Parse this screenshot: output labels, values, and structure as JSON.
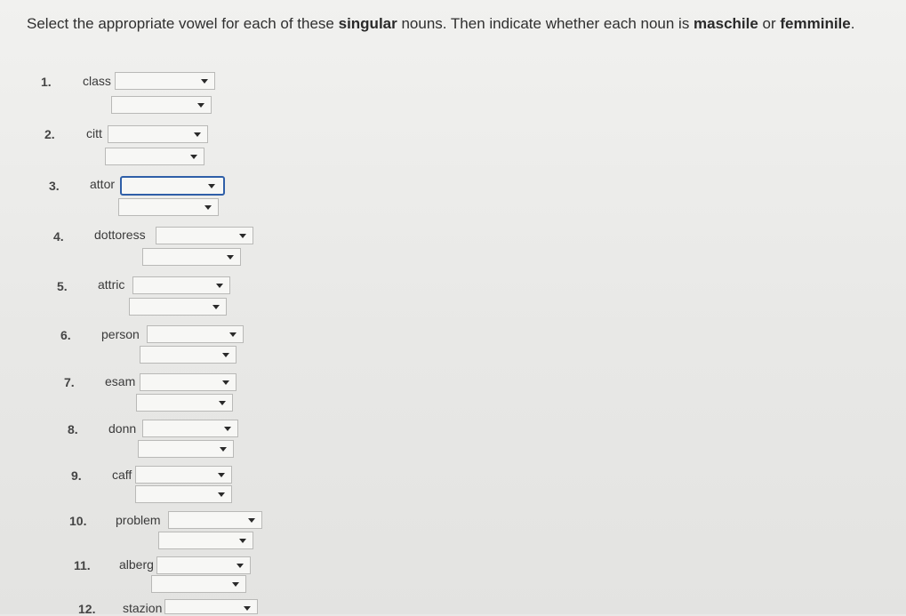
{
  "instructions": {
    "part1": "Select the appropriate vowel for each of these ",
    "bold1": "singular",
    "part2": " nouns. Then indicate whether each noun is ",
    "bold2": "maschile",
    "part3": " or ",
    "bold3": "femminile",
    "part4": "."
  },
  "items": [
    {
      "number": "1.",
      "stem": "class",
      "vowel": "",
      "gender": ""
    },
    {
      "number": "2.",
      "stem": "citt",
      "vowel": "",
      "gender": ""
    },
    {
      "number": "3.",
      "stem": "attor",
      "vowel": "",
      "gender": ""
    },
    {
      "number": "4.",
      "stem": "dottoress",
      "vowel": "",
      "gender": ""
    },
    {
      "number": "5.",
      "stem": "attric",
      "vowel": "",
      "gender": ""
    },
    {
      "number": "6.",
      "stem": "person",
      "vowel": "",
      "gender": ""
    },
    {
      "number": "7.",
      "stem": "esam",
      "vowel": "",
      "gender": ""
    },
    {
      "number": "8.",
      "stem": "donn",
      "vowel": "",
      "gender": ""
    },
    {
      "number": "9.",
      "stem": "caff",
      "vowel": "",
      "gender": ""
    },
    {
      "number": "10.",
      "stem": "problem",
      "vowel": "",
      "gender": ""
    },
    {
      "number": "11.",
      "stem": "alberg",
      "vowel": "",
      "gender": ""
    },
    {
      "number": "12.",
      "stem": "stazion",
      "vowel": "",
      "gender": ""
    }
  ]
}
